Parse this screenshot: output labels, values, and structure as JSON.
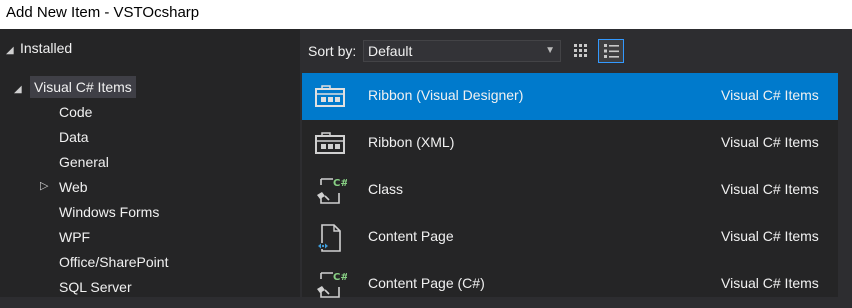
{
  "window": {
    "title": "Add New Item - VSTOcsharp"
  },
  "tree": {
    "installed_label": "Installed",
    "root_label": "Visual C# Items",
    "children": [
      "Code",
      "Data",
      "General",
      "Web",
      "Windows Forms",
      "WPF",
      "Office/SharePoint",
      "SQL Server"
    ]
  },
  "toolbar": {
    "sort_label": "Sort by:",
    "sort_value": "Default"
  },
  "items": [
    {
      "name": "Ribbon (Visual Designer)",
      "category": "Visual C# Items",
      "icon": "ribbon-icon"
    },
    {
      "name": "Ribbon (XML)",
      "category": "Visual C# Items",
      "icon": "ribbon-icon"
    },
    {
      "name": "Class",
      "category": "Visual C# Items",
      "icon": "csharp-class-icon"
    },
    {
      "name": "Content Page",
      "category": "Visual C# Items",
      "icon": "content-page-icon"
    },
    {
      "name": "Content Page (C#)",
      "category": "Visual C# Items",
      "icon": "csharp-class-icon"
    }
  ],
  "colors": {
    "selection": "#007acc",
    "background": "#252526",
    "chrome": "#2d2d30"
  }
}
